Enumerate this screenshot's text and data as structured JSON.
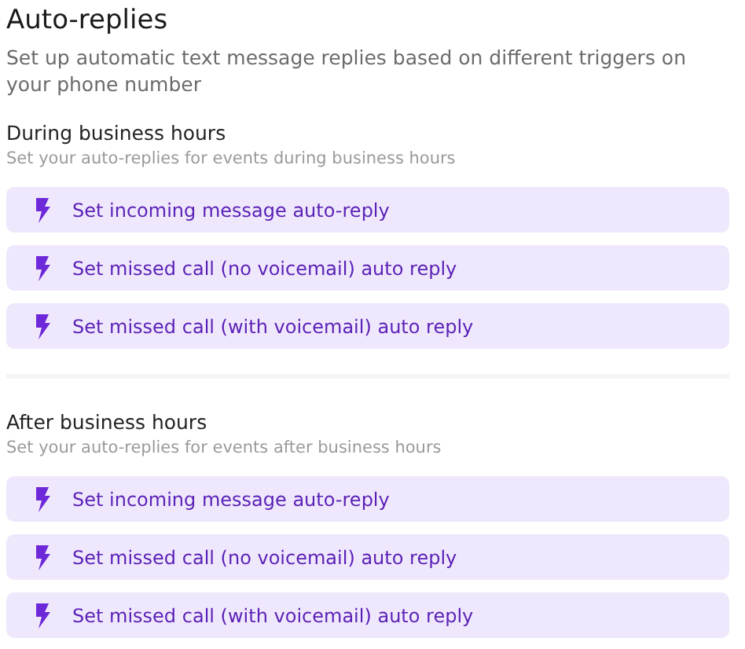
{
  "title": "Auto-replies",
  "description": "Set up automatic text message replies based on different triggers on your phone number",
  "sections": [
    {
      "heading": "During business hours",
      "subheading": "Set your auto-replies for events during business hours",
      "buttons": [
        "Set incoming message auto-reply",
        "Set missed call (no voicemail) auto reply",
        "Set missed call (with voicemail) auto reply"
      ]
    },
    {
      "heading": "After business hours",
      "subheading": "Set your auto-replies for events after business hours",
      "buttons": [
        "Set incoming message auto-reply",
        "Set missed call (no voicemail) auto reply",
        "Set missed call (with voicemail) auto reply"
      ]
    }
  ]
}
